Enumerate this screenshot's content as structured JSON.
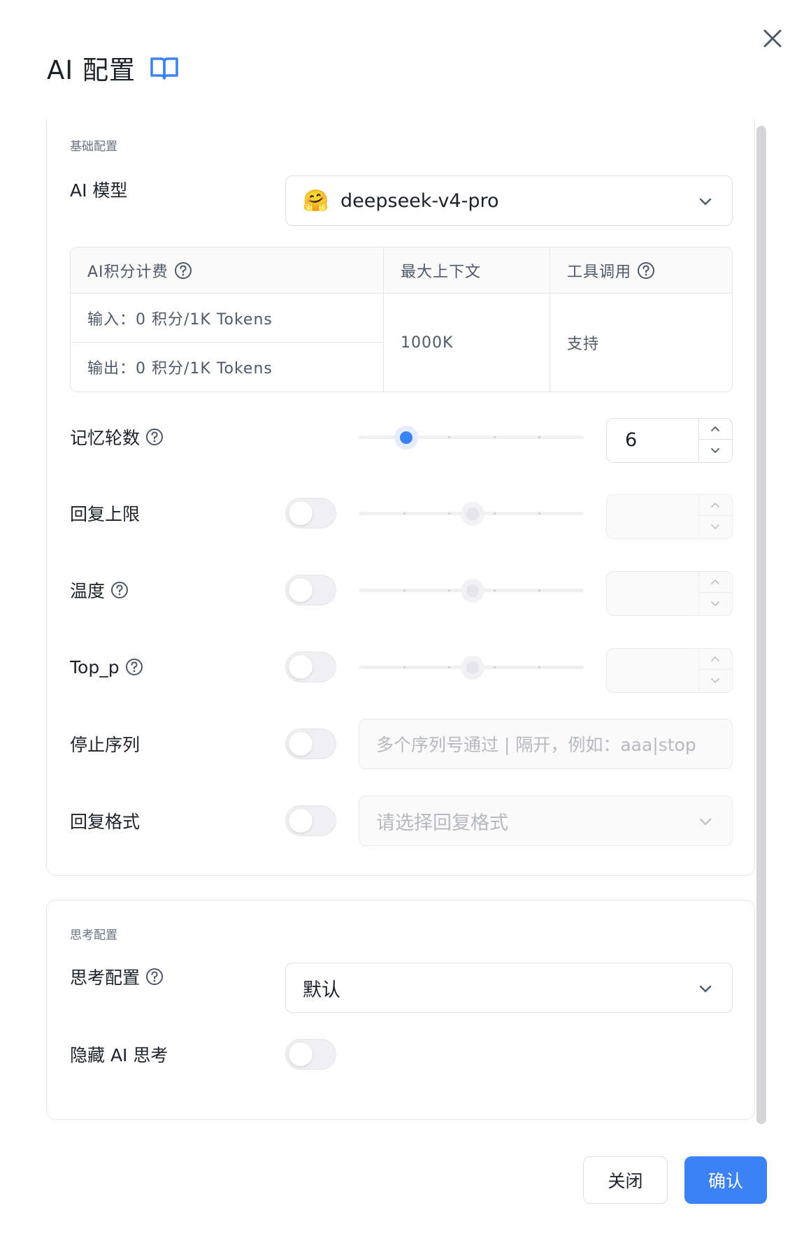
{
  "header": {
    "title": "AI 配置",
    "book_icon": "book-open-icon",
    "close_icon": "close-icon"
  },
  "basic": {
    "section_title": "基础配置",
    "model": {
      "label": "AI 模型",
      "value": "deepseek-v4-pro",
      "emoji": "🤗"
    },
    "info_table": {
      "col_credit": "AI积分计费",
      "col_context": "最大上下文",
      "col_tools": "工具调用",
      "input_cost": "输入：0 积分/1K Tokens",
      "output_cost": "输出：0 积分/1K Tokens",
      "context_value": "1000K",
      "tools_value": "支持"
    },
    "memory": {
      "label": "记忆轮数",
      "value": "6",
      "slider_fraction": 0.21
    },
    "reply_limit": {
      "label": "回复上限",
      "enabled": false,
      "value": ""
    },
    "temperature": {
      "label": "温度",
      "enabled": false,
      "value": ""
    },
    "top_p": {
      "label": "Top_p",
      "enabled": false,
      "value": ""
    },
    "stop_sequence": {
      "label": "停止序列",
      "enabled": false,
      "placeholder": "多个序列号通过 | 隔开，例如：aaa|stop"
    },
    "reply_format": {
      "label": "回复格式",
      "enabled": false,
      "placeholder": "请选择回复格式"
    }
  },
  "thinking": {
    "section_title": "思考配置",
    "config": {
      "label": "思考配置",
      "value": "默认"
    },
    "hide": {
      "label": "隐藏 AI 思考",
      "enabled": false
    }
  },
  "footer": {
    "close_label": "关闭",
    "confirm_label": "确认"
  },
  "colors": {
    "accent": "#3b82f6",
    "text_primary": "#1d2129",
    "border": "#dcdfe6"
  }
}
